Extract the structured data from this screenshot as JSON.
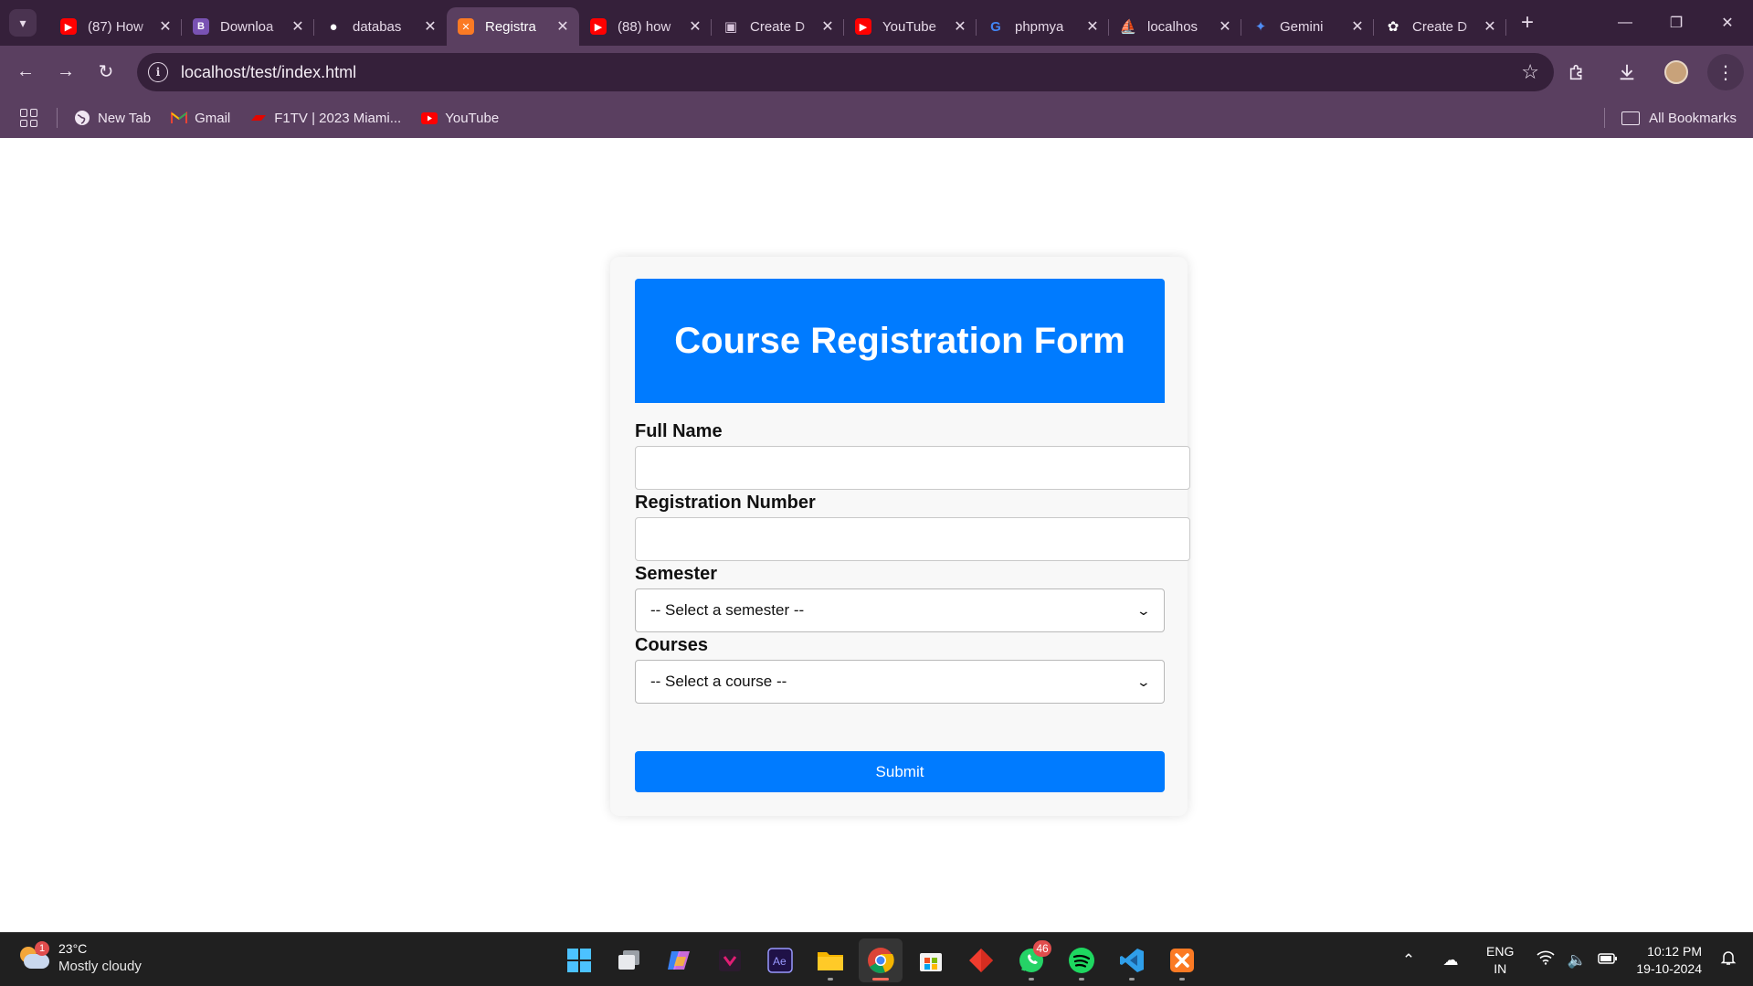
{
  "browser": {
    "tabs": [
      {
        "title": "(87) How",
        "favicon": "youtube-icon",
        "color": "#ff0000"
      },
      {
        "title": "Downloa",
        "favicon": "bootstrap-icon",
        "color": "#7952b3"
      },
      {
        "title": "databas",
        "favicon": "github-icon",
        "color": "#ffffff"
      },
      {
        "title": "Registra",
        "favicon": "xampp-icon",
        "color": "#fb7a24",
        "active": true
      },
      {
        "title": "(88) how",
        "favicon": "youtube-icon",
        "color": "#ff0000"
      },
      {
        "title": "Create D",
        "favicon": "image-icon",
        "color": "#d9c6dc"
      },
      {
        "title": "YouTube",
        "favicon": "youtube-icon",
        "color": "#ff0000"
      },
      {
        "title": "phpmya",
        "favicon": "google-icon",
        "color": "#4285f4"
      },
      {
        "title": "localhos",
        "favicon": "phpmyadmin-icon",
        "color": "#f29111"
      },
      {
        "title": "Gemini",
        "favicon": "gemini-icon",
        "color": "#4f8df5"
      },
      {
        "title": "Create D",
        "favicon": "chatgpt-icon",
        "color": "#ffffff"
      }
    ],
    "url": "localhost/test/index.html",
    "bookmarks": [
      {
        "label": "New Tab",
        "icon": "globe-icon"
      },
      {
        "label": "Gmail",
        "icon": "gmail-icon"
      },
      {
        "label": "F1TV | 2023 Miami...",
        "icon": "f1-icon"
      },
      {
        "label": "YouTube",
        "icon": "youtube-icon"
      }
    ],
    "all_bookmarks": "All Bookmarks"
  },
  "form": {
    "title": "Course Registration Form",
    "full_name_label": "Full Name",
    "full_name_value": "",
    "reg_number_label": "Registration Number",
    "reg_number_value": "",
    "semester_label": "Semester",
    "semester_selected": "-- Select a semester --",
    "courses_label": "Courses",
    "courses_selected": "-- Select a course --",
    "submit_label": "Submit",
    "accent_color": "#007bff"
  },
  "taskbar": {
    "weather_badge": "1",
    "temperature": "23°C",
    "weather_desc": "Mostly cloudy",
    "whatsapp_badge": "46",
    "lang_line1": "ENG",
    "lang_line2": "IN",
    "time": "10:12 PM",
    "date": "19-10-2024"
  }
}
